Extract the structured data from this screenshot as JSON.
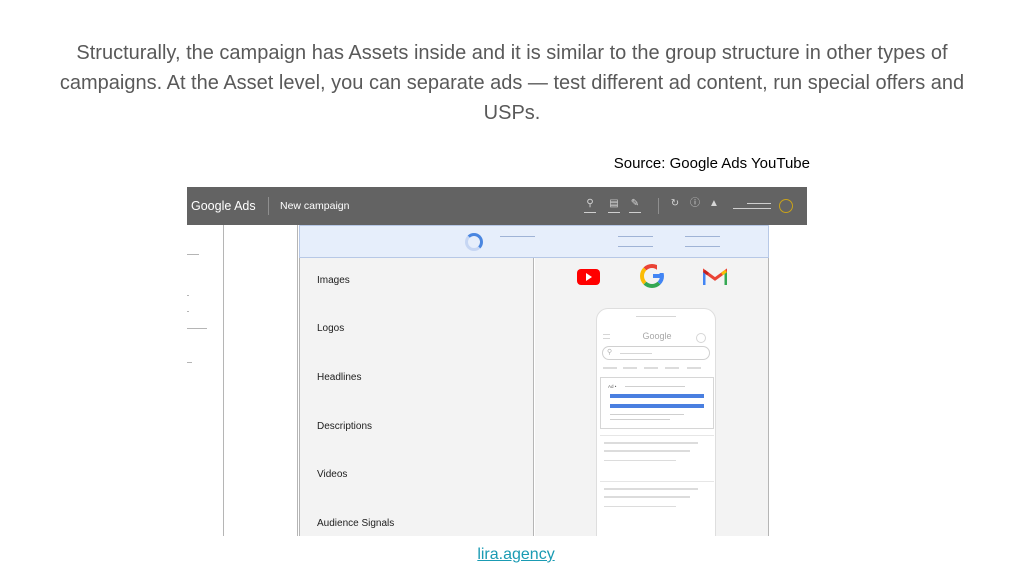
{
  "slide": {
    "text": "Structurally, the campaign has Assets inside and it is similar to the group structure in other types of campaigns. At the Asset level, you can separate ads — test different ad content, run special offers and USPs.",
    "source": "Source: Google Ads YouTube",
    "footer_link": "lira.agency"
  },
  "screenshot": {
    "brand": "Google Ads",
    "page_title": "New campaign",
    "toolbar_icons": [
      "search-icon",
      "reports-icon",
      "tools-icon",
      "refresh-icon",
      "help-icon",
      "notifications-icon"
    ],
    "asset_types": [
      "Images",
      "Logos",
      "Headlines",
      "Descriptions",
      "Videos",
      "Audience Signals"
    ],
    "preview_channels": [
      "youtube-icon",
      "google-icon",
      "gmail-icon"
    ],
    "phone_preview": {
      "search_brand": "Google",
      "ad_label": "Ad •"
    },
    "colors": {
      "topbar": "#636363",
      "progress_bg": "#e6eefb",
      "ad_headline": "#4a7fe0",
      "youtube": "#ff0000"
    }
  }
}
